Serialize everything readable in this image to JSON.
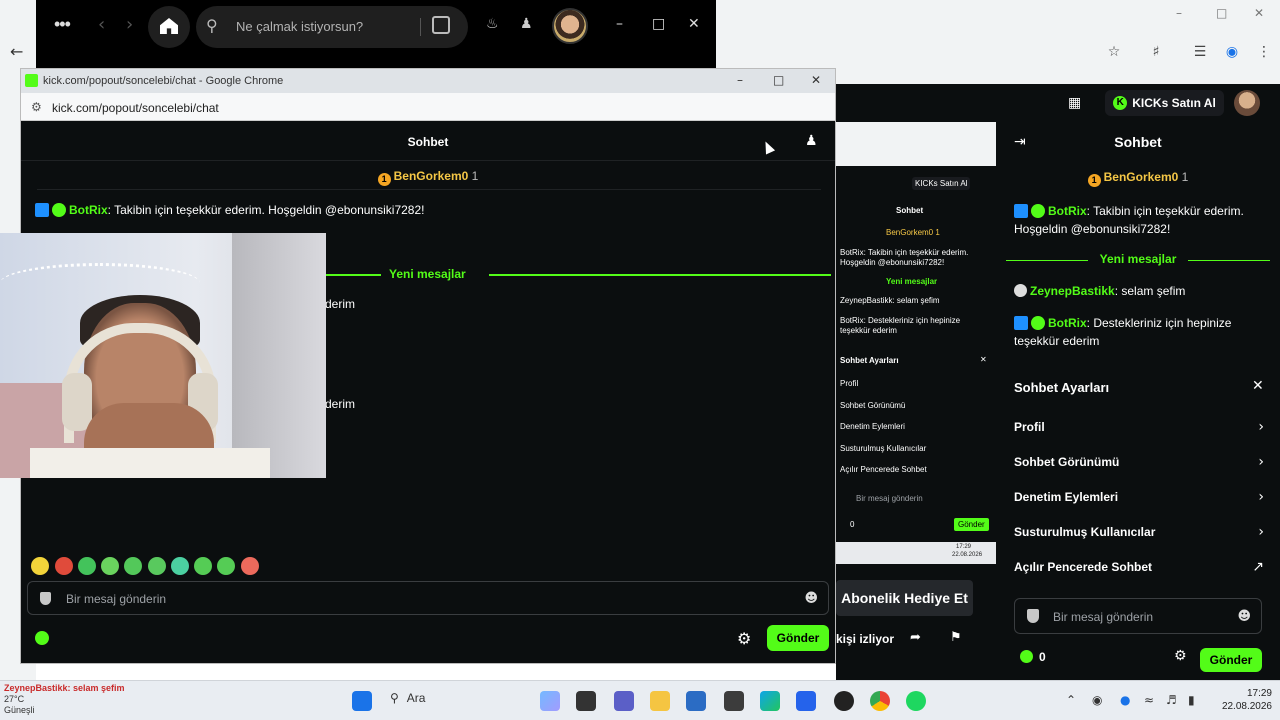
{
  "background_browser": {
    "window_controls": [
      "–",
      "□",
      "✕"
    ],
    "toolbar_icons": [
      "star-icon",
      "extension-icon",
      "media-icon",
      "profile-icon",
      "menu-icon"
    ]
  },
  "spotify": {
    "search_placeholder": "Ne çalmak istiyorsun?",
    "colors": {
      "bg": "#000000",
      "surface": "#1f1f1f"
    }
  },
  "kick_header": {
    "kicks_button": "KICKs Satın Al"
  },
  "right_chat": {
    "title": "Sohbet",
    "pinned_user": "BenGorkem0",
    "pinned_count": "1",
    "messages": [
      {
        "user": "BotRix",
        "text": ": Takibin için teşekkür ederim. Hoşgeldin @ebonunsiki7282!"
      },
      {
        "user": "ZeynepBastikk",
        "text": ": selam şefim"
      },
      {
        "user": "BotRix",
        "text": ": Destekleriniz için hepinize teşekkür ederim"
      }
    ],
    "new_messages": "Yeni mesajlar",
    "settings_title": "Sohbet Ayarları",
    "settings_items": [
      "Profil",
      "Sohbet Görünümü",
      "Denetim Eylemleri",
      "Susturulmuş Kullanıcılar",
      "Açılır Pencerede Sohbet"
    ],
    "input_placeholder": "Bir mesaj gönderin",
    "kicks_count": "0",
    "send_label": "Gönder"
  },
  "mini_screen": {
    "kicks_button": "KICKs Satın Al",
    "title": "Sohbet",
    "pinned": "BenGorkem0 1",
    "msg1a": "BotRix: Takibin için teşekkür ederim.",
    "msg1b": "Hoşgeldin @ebonunsiki7282!",
    "new_messages": "Yeni mesajlar",
    "msg2": "ZeynepBastikk: selam şefim",
    "msg3a": "BotRix: Destekleriniz için hepinize",
    "msg3b": "teşekkür ederim",
    "settings_title": "Sohbet Ayarları",
    "settings_items": [
      "Profil",
      "Sohbet Görünümü",
      "Denetim Eylemleri",
      "Susturulmuş Kullanıcılar",
      "Açılır Pencerede Sohbet"
    ],
    "input_placeholder": "Bir mesaj gönderin",
    "kicks_count": "0",
    "send_label": "Gönder",
    "clock_time": "17:29",
    "clock_date": "22.08.2026"
  },
  "stream_actions": {
    "subscribe_gift": "Abonelik Hediye Et",
    "viewers": "kişi izliyor"
  },
  "popup": {
    "window_title": "kick.com/popout/soncelebi/chat - Google Chrome",
    "url": "kick.com/popout/soncelebi/chat",
    "chat_title": "Sohbet",
    "pinned_user": "BenGorkem0",
    "pinned_count": "1",
    "message1_user": "BotRix",
    "message1_text": ": Takibin için teşekkür ederim. Hoşgeldin @ebonunsiki7282!",
    "new_messages": "Yeni mesajlar",
    "partial_1": "derim",
    "partial_2": "derim",
    "emotes": [
      "#f2d43a",
      "#e04b3b",
      "#43c35b",
      "#6ad35e",
      "#53c85a",
      "#59c95e",
      "#4bd0a1",
      "#55cc55",
      "#55cc55",
      "#ec6a5c"
    ],
    "input_placeholder": "Bir mesaj gönderin",
    "send_label": "Gönder",
    "accent": "#53fc18"
  },
  "taskbar": {
    "weather_lines": [
      "ZeynepBastikk: selam şefim",
      "27°C",
      "Güneşli"
    ],
    "search_label": "Ara",
    "clock_time": "17:29",
    "clock_date": "22.08.2026"
  }
}
